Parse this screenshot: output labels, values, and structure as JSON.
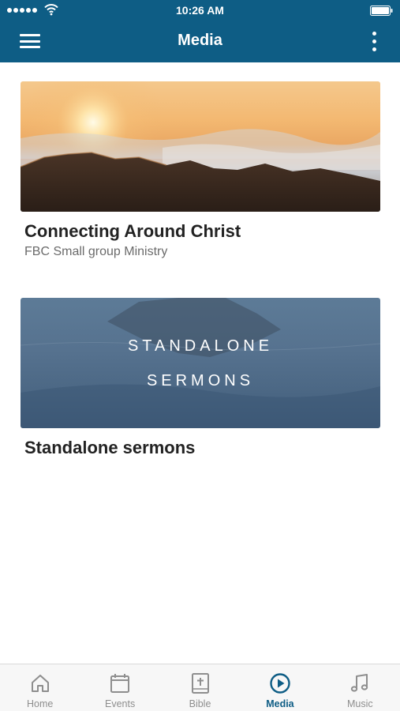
{
  "status_bar": {
    "time": "10:26 AM",
    "signal_icon": "signal-dots-icon",
    "wifi_icon": "wifi-icon",
    "battery_icon": "battery-icon"
  },
  "header": {
    "title": "Media",
    "menu_icon": "hamburger-menu-icon",
    "more_icon": "more-vertical-icon",
    "background_color": "#0e5d85"
  },
  "media_items": [
    {
      "title": "Connecting Around Christ",
      "subtitle": "FBC Small group Ministry",
      "image": "sunrise-over-mountains"
    },
    {
      "title": "Standalone sermons",
      "image_text_line1": "STANDALONE",
      "image_text_line2": "SERMONS",
      "image": "ocean-rock-cover"
    }
  ],
  "tabs": [
    {
      "label": "Home",
      "icon": "home-icon",
      "active": false
    },
    {
      "label": "Events",
      "icon": "calendar-icon",
      "active": false
    },
    {
      "label": "Bible",
      "icon": "bible-icon",
      "active": false
    },
    {
      "label": "Media",
      "icon": "play-circle-icon",
      "active": true
    },
    {
      "label": "Music",
      "icon": "music-note-icon",
      "active": false
    }
  ],
  "colors": {
    "accent": "#0e5d85",
    "tab_inactive": "#8e8e8e"
  }
}
